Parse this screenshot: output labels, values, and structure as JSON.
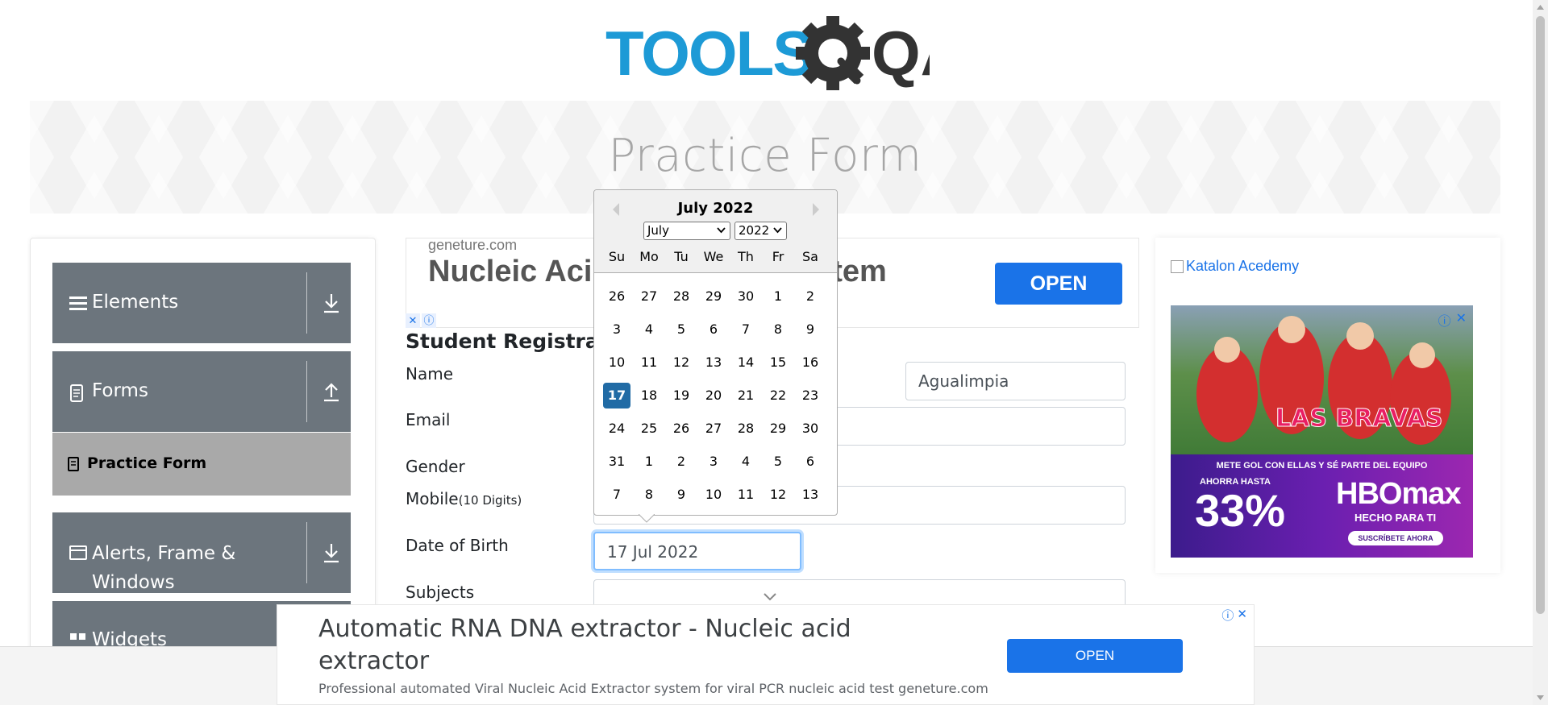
{
  "logo": {
    "text_left": "TOOLS",
    "text_right": "QA",
    "alt": "TOOLSQA"
  },
  "banner": {
    "title": "Practice Form"
  },
  "sidebar": {
    "groups": [
      {
        "label": "Elements"
      },
      {
        "label": "Forms"
      },
      {
        "label": "Alerts, Frame & Windows"
      },
      {
        "label": "Widgets"
      }
    ],
    "active_item": "Practice Form"
  },
  "ad_top": {
    "domain": "geneture.com",
    "headline": "Nucleic Acid Extraction System",
    "open_label": "OPEN"
  },
  "form": {
    "heading": "Student Registration Form",
    "labels": {
      "name": "Name",
      "email": "Email",
      "gender": "Gender",
      "mobile": "Mobile",
      "mobile_hint": "(10 Digits)",
      "dob": "Date of Birth",
      "subjects": "Subjects"
    },
    "last_name_value": "Agualimpia",
    "dob_value": "17 Jul 2022"
  },
  "datepicker": {
    "title": "July 2022",
    "month_select": "July",
    "year_select": "2022",
    "day_names": [
      "Su",
      "Mo",
      "Tu",
      "We",
      "Th",
      "Fr",
      "Sa"
    ],
    "weeks": [
      [
        "26",
        "27",
        "28",
        "29",
        "30",
        "1",
        "2"
      ],
      [
        "3",
        "4",
        "5",
        "6",
        "7",
        "8",
        "9"
      ],
      [
        "10",
        "11",
        "12",
        "13",
        "14",
        "15",
        "16"
      ],
      [
        "17",
        "18",
        "19",
        "20",
        "21",
        "22",
        "23"
      ],
      [
        "24",
        "25",
        "26",
        "27",
        "28",
        "29",
        "30"
      ],
      [
        "31",
        "1",
        "2",
        "3",
        "4",
        "5",
        "6"
      ],
      [
        "7",
        "8",
        "9",
        "10",
        "11",
        "12",
        "13"
      ]
    ],
    "selected_day": "17"
  },
  "right_ad": {
    "link_text": "Katalon Acedemy",
    "hbo": {
      "tagline": "METE GOL CON ELLAS Y SÉ PARTE DEL EQUIPO",
      "upto": "AHORRA HASTA",
      "percent": "33%",
      "brand": "HBOmax",
      "sub": "HECHO PARA TI",
      "cta": "SUSCRÍBETE AHORA",
      "show": "LAS BRAVAS"
    }
  },
  "bottom_ad": {
    "headline": "Automatic RNA DNA extractor - Nucleic acid extractor",
    "description": "Professional automated Viral Nucleic Acid Extractor system for viral PCR nucleic acid test geneture.com",
    "open_label": "OPEN"
  },
  "colors": {
    "sidebar_header": "#6c757d",
    "sidebar_active": "#a9a9a9",
    "accent_blue": "#1a73e8",
    "datepicker_selected": "#216ba5",
    "logo_blue": "#1d9ad6",
    "logo_dark": "#333333"
  }
}
